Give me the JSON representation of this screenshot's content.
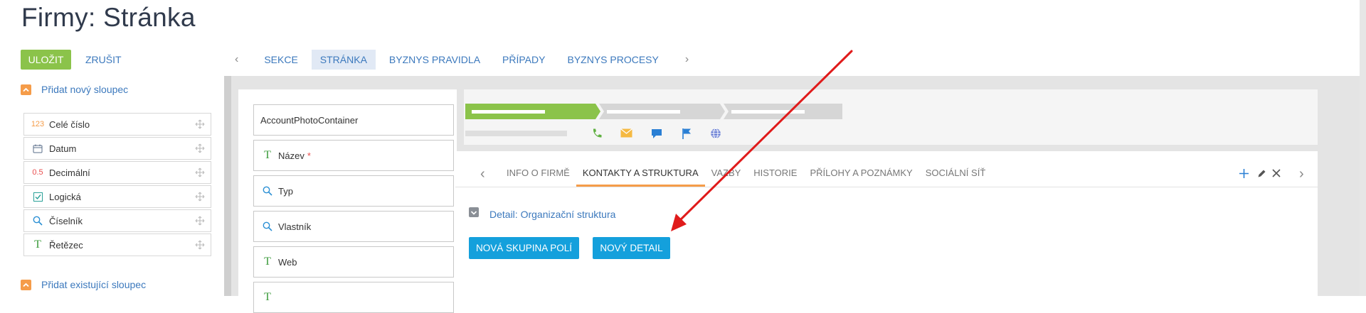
{
  "page": {
    "title": "Firmy: Stránka"
  },
  "toolbar": {
    "save_label": "ULOŽIT",
    "cancel_label": "ZRUŠIT"
  },
  "left_panel": {
    "add_new_column_label": "Přidat nový sloupec",
    "add_existing_column_label": "Přidat existující sloupec",
    "column_types": [
      {
        "label": "Celé číslo",
        "icon": "integer-icon",
        "icon_text": "123",
        "icon_color": "#f59c49"
      },
      {
        "label": "Datum",
        "icon": "calendar-icon"
      },
      {
        "label": "Decimální",
        "icon": "decimal-icon",
        "icon_text": "0.5",
        "icon_color": "#e94e4e"
      },
      {
        "label": "Logická",
        "icon": "checkbox-icon"
      },
      {
        "label": "Číselník",
        "icon": "search-icon"
      },
      {
        "label": "Řetězec",
        "icon": "text-icon",
        "icon_text": "T"
      }
    ]
  },
  "top_nav": {
    "tabs": [
      {
        "label": "SEKCE"
      },
      {
        "label": "STRÁNKA",
        "active": true
      },
      {
        "label": "BYZNYS PRAVIDLA"
      },
      {
        "label": "PŘÍPADY"
      },
      {
        "label": "BYZNYS PROCESY"
      }
    ]
  },
  "fields": [
    {
      "label": "AccountPhotoContainer",
      "icon": ""
    },
    {
      "label": "Název",
      "required_mark": "*",
      "icon": "text-icon",
      "icon_text": "T"
    },
    {
      "label": "Typ",
      "icon": "search-icon"
    },
    {
      "label": "Vlastník",
      "icon": "search-icon"
    },
    {
      "label": "Web",
      "icon": "text-icon",
      "icon_text": "T"
    },
    {
      "label": "",
      "icon": "text-icon",
      "icon_text": "T"
    }
  ],
  "header_panel": {
    "action_icons": [
      "phone-icon",
      "email-icon",
      "chat-icon",
      "flag-icon",
      "globe-icon"
    ],
    "colors": {
      "phone": "#5fb040",
      "email": "#f5b942",
      "chat": "#2a7fd4",
      "flag": "#2a7fd4",
      "globe": "#6a7fd4",
      "progress": "#8bc34a"
    }
  },
  "detail_tabs": {
    "tabs": [
      {
        "label": "INFO O FIRMĚ"
      },
      {
        "label": "KONTAKTY A STRUKTURA",
        "active": true
      },
      {
        "label": "VAZBY"
      },
      {
        "label": "HISTORIE"
      },
      {
        "label": "PŘÍLOHY A POZNÁMKY"
      },
      {
        "label": "SOCIÁLNÍ SÍŤ"
      }
    ],
    "detail_label": "Detail: Organizační struktura",
    "new_group_button": "NOVÁ SKUPINA POLÍ",
    "new_detail_button": "NOVÝ DETAIL"
  },
  "annotation": {
    "arrow_color": "#e01b1b"
  }
}
